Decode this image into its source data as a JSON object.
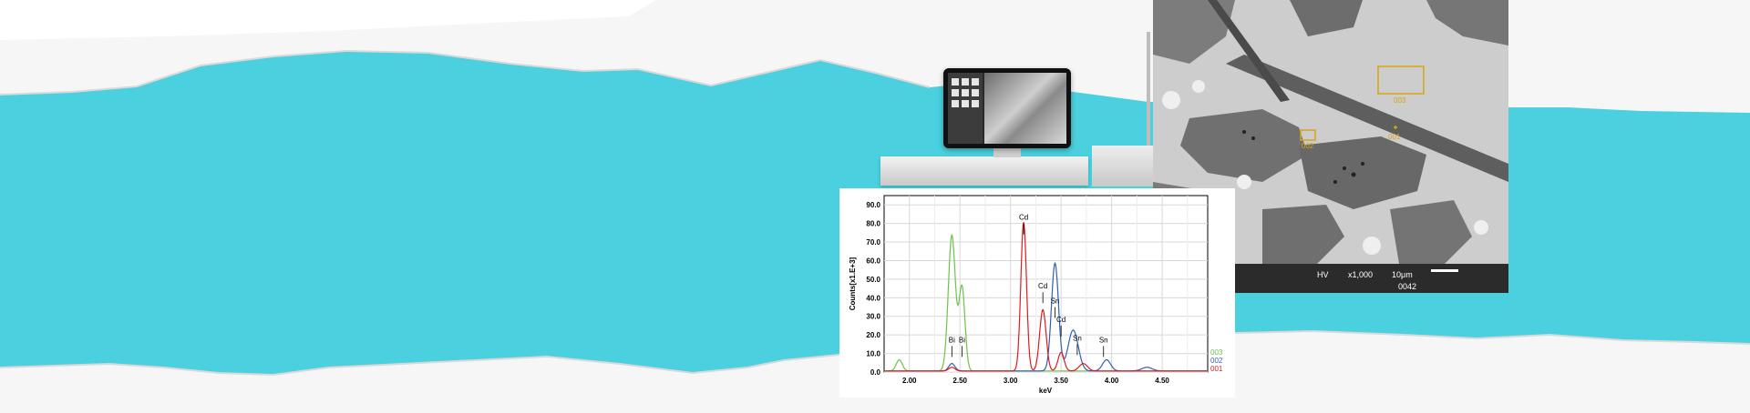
{
  "sem": {
    "mode": "HV",
    "magnification": "x1,000",
    "scale": "10μm",
    "image_no": "0042",
    "rois": [
      "001",
      "002",
      "003"
    ]
  },
  "colors": {
    "teal": "#4ad0de",
    "paper": "#f6f6f6",
    "series_003": "#6cc44a",
    "series_002": "#2f5fb5",
    "series_001": "#e01b1b"
  },
  "chart_data": {
    "type": "line",
    "xlabel": "keV",
    "ylabel": "Counts[x1.E+3]",
    "xlim": [
      1.75,
      4.95
    ],
    "ylim": [
      0,
      95
    ],
    "x_ticks": [
      "2.00",
      "2.50",
      "3.00",
      "3.50",
      "4.00",
      "4.50"
    ],
    "y_ticks": [
      "0.0",
      "10.0",
      "20.0",
      "30.0",
      "40.0",
      "50.0",
      "60.0",
      "70.0",
      "80.0",
      "90.0"
    ],
    "grid": true,
    "legend": "right",
    "series": [
      {
        "name": "003",
        "color": "#6cc44a",
        "peaks": [
          [
            1.9,
            6,
            0.03
          ],
          [
            2.42,
            73,
            0.035
          ],
          [
            2.52,
            45,
            0.03
          ]
        ]
      },
      {
        "name": "002",
        "color": "#2f5fb5",
        "peaks": [
          [
            2.42,
            4,
            0.03
          ],
          [
            3.44,
            58,
            0.035
          ],
          [
            3.62,
            22,
            0.05
          ],
          [
            3.95,
            6,
            0.04
          ],
          [
            4.35,
            2,
            0.05
          ]
        ]
      },
      {
        "name": "001",
        "color": "#e01b1b",
        "peaks": [
          [
            2.42,
            2,
            0.03
          ],
          [
            3.13,
            80,
            0.028
          ],
          [
            3.32,
            33,
            0.032
          ],
          [
            3.5,
            10,
            0.03
          ],
          [
            3.72,
            4,
            0.04
          ]
        ]
      }
    ],
    "annotations": [
      {
        "text": "Cd",
        "x": 3.13,
        "y": 81
      },
      {
        "text": "Cd",
        "x": 3.32,
        "y": 44
      },
      {
        "text": "Cd",
        "x": 3.5,
        "y": 26
      },
      {
        "text": "Sn",
        "x": 3.44,
        "y": 36
      },
      {
        "text": "Sn",
        "x": 3.66,
        "y": 16
      },
      {
        "text": "Sn",
        "x": 3.92,
        "y": 15
      },
      {
        "text": "Bi",
        "x": 2.42,
        "y": 15
      },
      {
        "text": "Bi",
        "x": 2.52,
        "y": 15
      }
    ]
  }
}
